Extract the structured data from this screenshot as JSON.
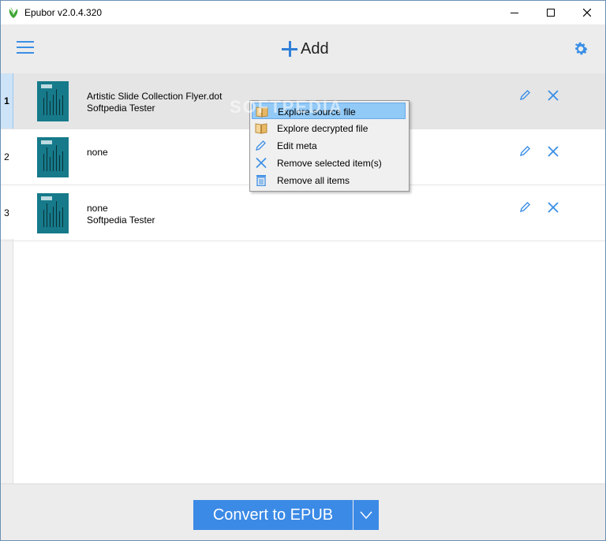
{
  "window": {
    "title": "Epubor v2.0.4.320"
  },
  "toolbar": {
    "menu_icon": "hamburger-icon",
    "add_label": "Add",
    "settings_icon": "gear-icon"
  },
  "books": [
    {
      "num": "1",
      "title": "Artistic Slide Collection Flyer.dot",
      "author": "Softpedia Tester",
      "selected": true
    },
    {
      "num": "2",
      "title": "none",
      "author": "",
      "selected": false
    },
    {
      "num": "3",
      "title": "none",
      "author": "Softpedia Tester",
      "selected": false
    }
  ],
  "context_menu": {
    "items": [
      {
        "label": "Explore source file",
        "icon": "book-icon",
        "active": true
      },
      {
        "label": "Explore decrypted file",
        "icon": "book-icon",
        "active": false
      },
      {
        "label": "Edit meta",
        "icon": "pencil-icon",
        "active": false
      },
      {
        "label": "Remove selected item(s)",
        "icon": "x-icon",
        "active": false
      },
      {
        "label": "Remove all items",
        "icon": "trash-icon",
        "active": false
      }
    ]
  },
  "watermark": "SOFTPEDIA",
  "footer": {
    "convert_label": "Convert to EPUB",
    "dropdown_icon": "chevron-down-icon"
  },
  "colors": {
    "accent": "#3b8ae6",
    "selected_row": "#e5e5e5",
    "cover": "#167a8a"
  }
}
